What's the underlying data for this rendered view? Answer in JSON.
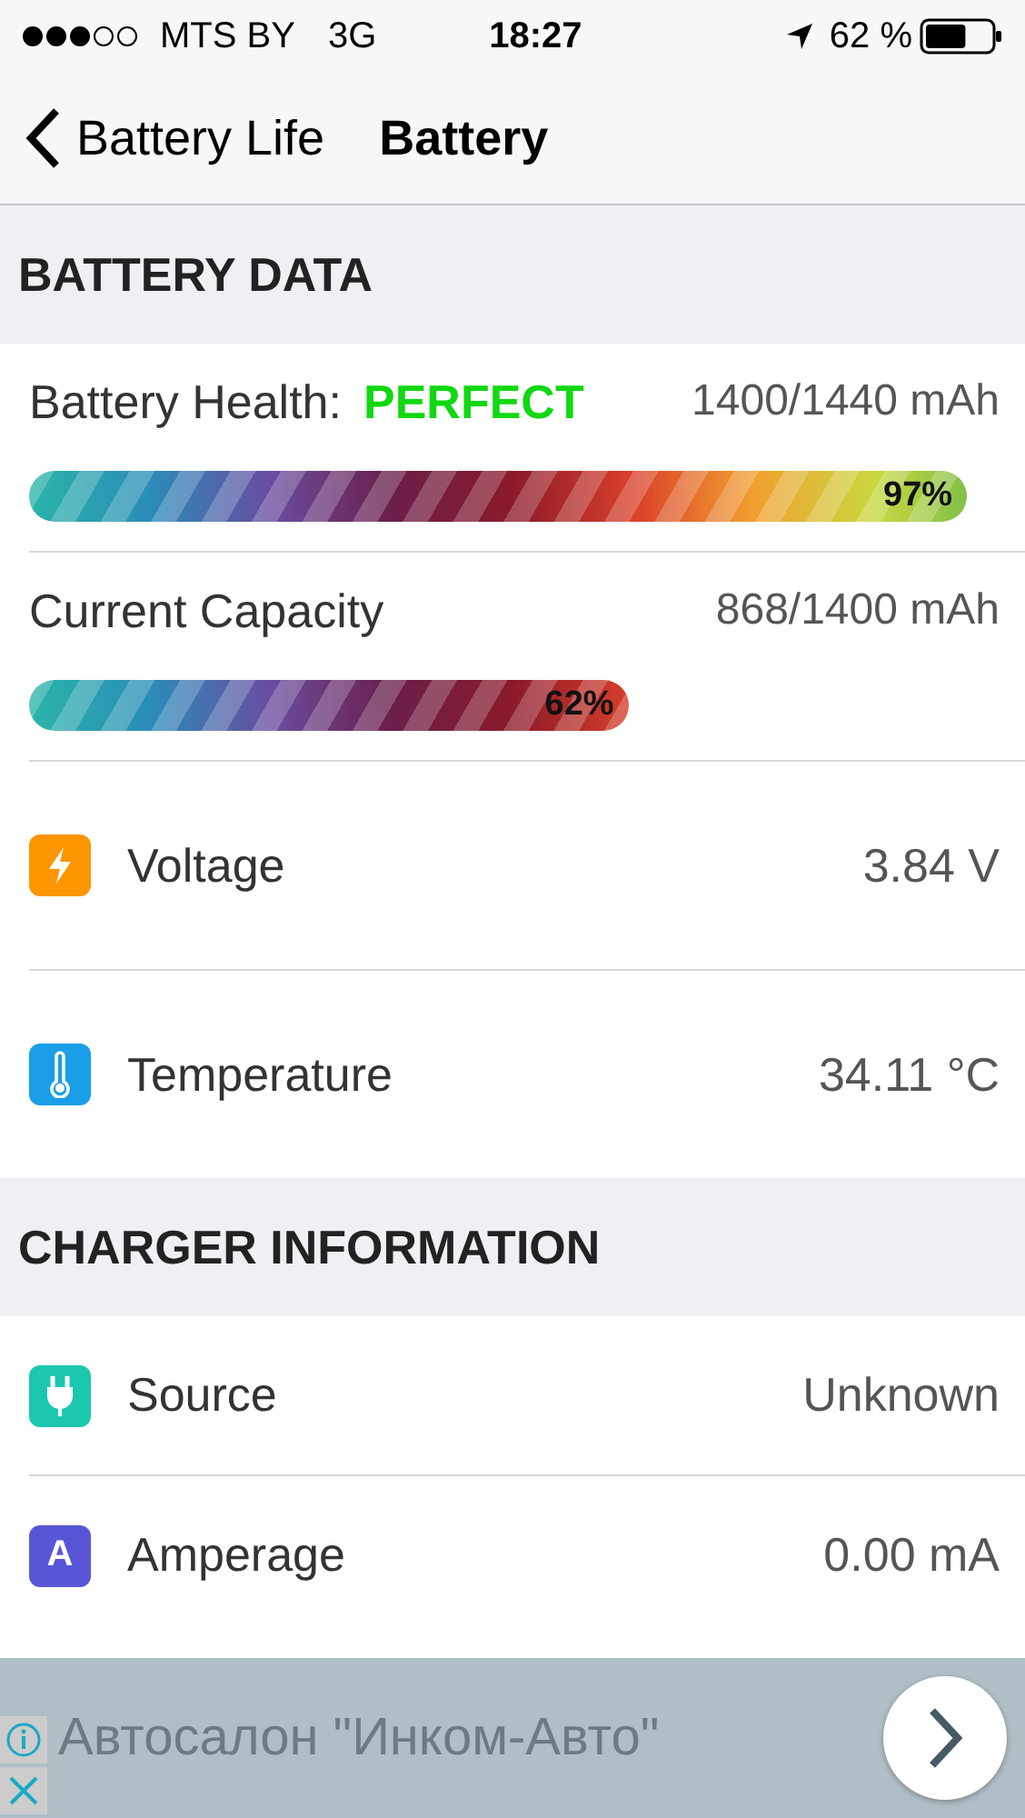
{
  "status_bar": {
    "carrier": "MTS BY",
    "network": "3G",
    "time": "18:27",
    "battery": "62 %"
  },
  "nav": {
    "back": "Battery Life",
    "title": "Battery"
  },
  "sections": [
    {
      "title": "BATTERY DATA",
      "rows": [
        {
          "kind": "bar",
          "label": "Battery Health:",
          "status": "PERFECT",
          "value": "1400/1440 mAh",
          "level": 0.97,
          "reading": "97%"
        },
        {
          "kind": "bar",
          "label": "Current Capacity",
          "value": "868/1400 mAh",
          "level": 0.62,
          "reading": "62%"
        },
        {
          "kind": "icon",
          "label": "Voltage",
          "value": "3.84 V",
          "color": "#ff9500"
        },
        {
          "kind": "icon",
          "label": "Temperature",
          "value": "34.11 °C",
          "color": "#1a9ee8"
        }
      ]
    },
    {
      "title": "CHARGER INFORMATION",
      "rows": [
        {
          "kind": "icon",
          "label": "Source",
          "value": "Unknown",
          "color": "#1cc7b0"
        },
        {
          "kind": "icon",
          "label": "Amperage",
          "value": "0.00 mA",
          "color": "#5856d6",
          "icon_text": "A"
        }
      ]
    }
  ],
  "ad": {
    "text": "Автосалон \"Инком-Авто\""
  }
}
